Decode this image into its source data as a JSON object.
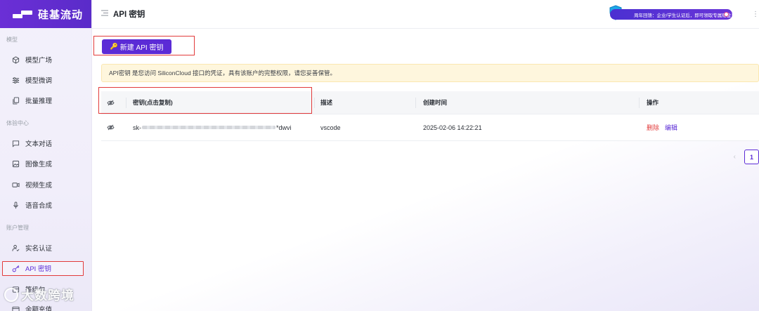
{
  "app": {
    "logo_text": "硅基流动",
    "page_title": "API 密钥",
    "promo_text": "周年回馈：企业/学生认证后，即可领取专属赠金！",
    "brand_color": "#5b2bd6"
  },
  "sidebar": {
    "sections": [
      {
        "label": "模型",
        "items": [
          {
            "label": "模型广场",
            "icon": "cube-icon"
          },
          {
            "label": "模型微调",
            "icon": "sliders-icon"
          },
          {
            "label": "批量推理",
            "icon": "copy-icon"
          }
        ]
      },
      {
        "label": "体验中心",
        "items": [
          {
            "label": "文本对话",
            "icon": "chat-icon"
          },
          {
            "label": "图像生成",
            "icon": "image-icon"
          },
          {
            "label": "视频生成",
            "icon": "video-icon"
          },
          {
            "label": "语音合成",
            "icon": "microphone-icon"
          }
        ]
      },
      {
        "label": "账户管理",
        "items": [
          {
            "label": "实名认证",
            "icon": "user-check-icon"
          },
          {
            "label": "API 密钥",
            "icon": "key-icon",
            "active": true
          },
          {
            "label": "等级包",
            "icon": "package-icon"
          },
          {
            "label": "余额充值",
            "icon": "wallet-icon"
          }
        ]
      }
    ]
  },
  "main": {
    "create_button": "新建 API 密钥",
    "notice": "API密钥 是您访问 SiliconCloud 接口的凭证，具有该账户的完整权限，请您妥善保管。",
    "table": {
      "headers": {
        "key": "密钥(点击复制)",
        "desc": "描述",
        "created": "创建时间",
        "actions": "操作"
      },
      "rows": [
        {
          "key_prefix": "sk-",
          "key_suffix": "*dwvi",
          "desc": "vscode",
          "created": "2025-02-06 14:22:21",
          "action_delete": "删除",
          "action_edit": "编辑"
        }
      ]
    },
    "pagination": {
      "current": "1"
    }
  },
  "watermark": "大数跨境"
}
